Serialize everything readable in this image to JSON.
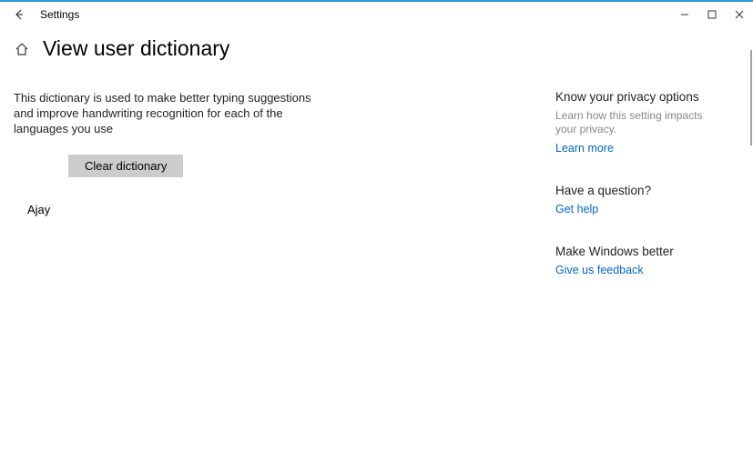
{
  "window": {
    "app_title": "Settings"
  },
  "header": {
    "title": "View user dictionary"
  },
  "main": {
    "description": "This dictionary is used to make better typing suggestions and improve handwriting recognition for each of the languages you use",
    "clear_button": "Clear dictionary",
    "words": [
      "Ajay"
    ]
  },
  "sidebar": {
    "privacy": {
      "heading": "Know your privacy options",
      "desc": "Learn how this setting impacts your privacy.",
      "link": "Learn more"
    },
    "question": {
      "heading": "Have a question?",
      "link": "Get help"
    },
    "feedback": {
      "heading": "Make Windows better",
      "link": "Give us feedback"
    }
  }
}
